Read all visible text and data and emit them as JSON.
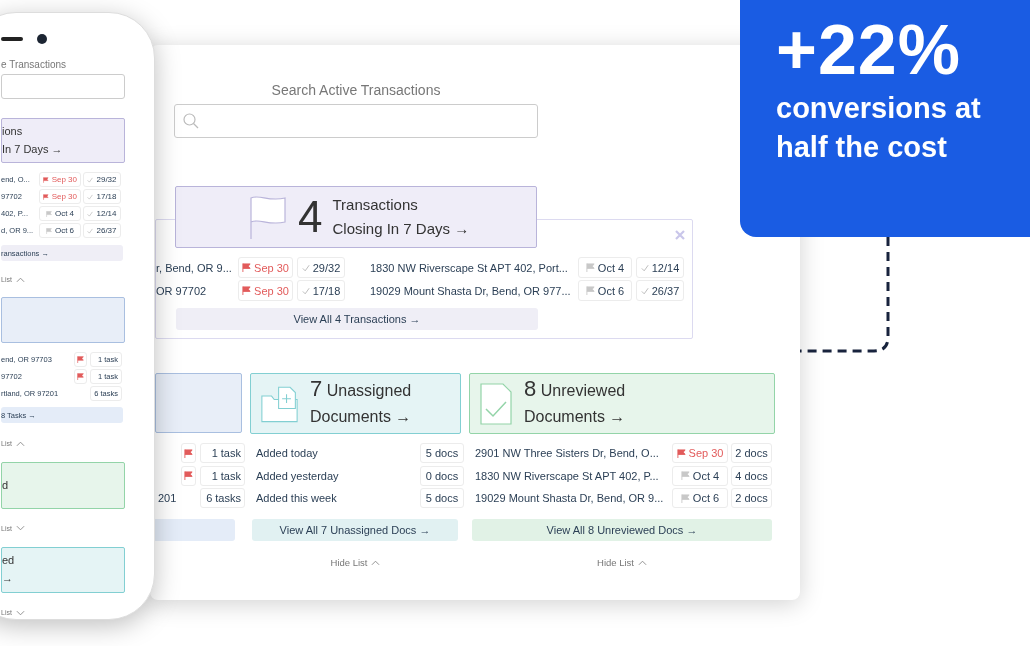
{
  "phone": {
    "search": {
      "label": "e Transactions"
    },
    "closing": {
      "title": "ions",
      "subtitle": "In 7 Days →",
      "rows": [
        {
          "address": "end, O...",
          "date": "Sep 30",
          "urgent": true,
          "progress": "29/32"
        },
        {
          "address": "97702",
          "date": "Sep 30",
          "urgent": true,
          "progress": "17/18"
        },
        {
          "address": "402, P...",
          "date": "Oct 4",
          "urgent": false,
          "progress": "12/14"
        },
        {
          "address": "d, OR 9...",
          "date": "Oct 6",
          "urgent": false,
          "progress": "26/37"
        }
      ],
      "view_all": "ransactions →",
      "hide": {
        "label": "List",
        "expanded": true
      }
    },
    "tasks": {
      "rows": [
        {
          "address": "end, OR 97703",
          "flagged": true,
          "count": "1 task"
        },
        {
          "address": "97702",
          "flagged": true,
          "count": "1 task"
        },
        {
          "address": "rtland, OR 97201",
          "flagged": false,
          "count": "6 tasks"
        }
      ],
      "view_all": "8 Tasks →",
      "hide": {
        "label": "List",
        "expanded": true
      }
    },
    "cards": [
      {
        "kind": "green",
        "title": "d",
        "hide": {
          "label": "List",
          "expanded": false
        }
      },
      {
        "kind": "teal",
        "title": "ed",
        "subtitle": "→",
        "hide": {
          "label": "List",
          "expanded": false
        }
      }
    ]
  },
  "desktop": {
    "search": {
      "label": "Search Active Transactions"
    },
    "closing": {
      "count": "4",
      "title": "Transactions",
      "subtitle": "Closing In 7 Days →",
      "rows": [
        {
          "address": "r, Bend, OR 9...",
          "date": "Sep 30",
          "urgent": true,
          "progress": "29/32"
        },
        {
          "address": "OR 97702",
          "date": "Sep 30",
          "urgent": true,
          "progress": "17/18"
        },
        {
          "address": "1830 NW Riverscape St APT 402, Port...",
          "date": "Oct 4",
          "urgent": false,
          "progress": "12/14"
        },
        {
          "address": "19029 Mount Shasta Dr, Bend, OR 977...",
          "date": "Oct 6",
          "urgent": false,
          "progress": "26/37"
        }
      ],
      "view_all": "View All 4 Transactions →"
    },
    "tasks": {
      "rows": [
        {
          "flagged": true,
          "count": "1 task"
        },
        {
          "flagged": true,
          "count": "1 task"
        },
        {
          "address": "201",
          "flagged": false,
          "count": "6 tasks"
        }
      ]
    },
    "unassigned": {
      "count": "7",
      "title": "Unassigned",
      "subtitle": "Documents →",
      "rows": [
        {
          "label": "Added today",
          "count": "5 docs"
        },
        {
          "label": "Added yesterday",
          "count": "0 docs"
        },
        {
          "label": "Added this week",
          "count": "5 docs"
        }
      ],
      "view_all": "View All 7 Unassigned Docs →",
      "hide": {
        "label": "Hide List",
        "expanded": true
      }
    },
    "unreviewed": {
      "count": "8",
      "title": "Unreviewed",
      "subtitle": "Documents →",
      "rows": [
        {
          "address": "2901 NW Three Sisters Dr, Bend, O...",
          "date": "Sep 30",
          "urgent": true,
          "count": "2 docs"
        },
        {
          "address": "1830 NW Riverscape St APT 402, P...",
          "date": "Oct 4",
          "urgent": false,
          "count": "4 docs"
        },
        {
          "address": "19029 Mount Shasta Dr, Bend, OR 9...",
          "date": "Oct 6",
          "urgent": false,
          "count": "2 docs"
        }
      ],
      "view_all": "View All 8 Unreviewed Docs →",
      "hide": {
        "label": "Hide List",
        "expanded": true
      }
    }
  },
  "callout": {
    "figure": "+22%",
    "text": "conversions at half the cost"
  }
}
